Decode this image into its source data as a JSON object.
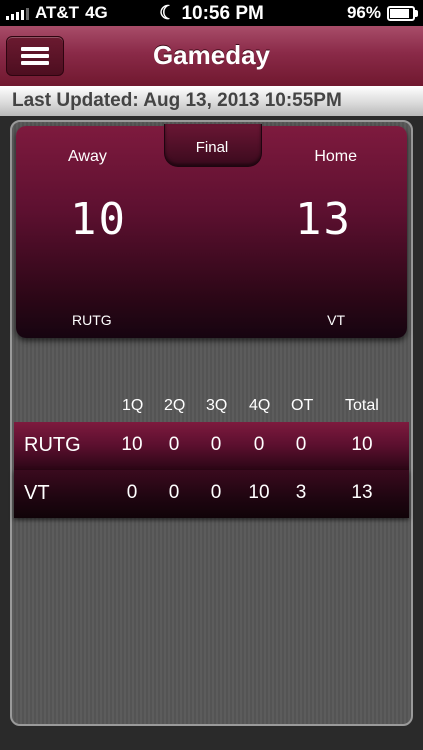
{
  "status_bar": {
    "carrier": "AT&T",
    "network": "4G",
    "time": "10:56 PM",
    "battery": "96%",
    "battery_level": 0.96
  },
  "nav": {
    "title": "Gameday",
    "menu_icon": "hamburger-menu-icon"
  },
  "updated": {
    "text": "Last Updated: Aug 13, 2013 10:55PM"
  },
  "scoreboard": {
    "status": "Final",
    "away_label": "Away",
    "home_label": "Home",
    "away_score": "10",
    "home_score": "13",
    "away_team": "RUTG",
    "home_team": "VT"
  },
  "quarters": {
    "headers": [
      "1Q",
      "2Q",
      "3Q",
      "4Q",
      "OT",
      "Total"
    ],
    "rows": [
      {
        "team": "RUTG",
        "values": [
          "10",
          "0",
          "0",
          "0",
          "0",
          "10"
        ]
      },
      {
        "team": "VT",
        "values": [
          "0",
          "0",
          "0",
          "10",
          "3",
          "13"
        ]
      }
    ]
  },
  "colors": {
    "accent": "#8a2a48",
    "panel": "#5a5a5a"
  }
}
